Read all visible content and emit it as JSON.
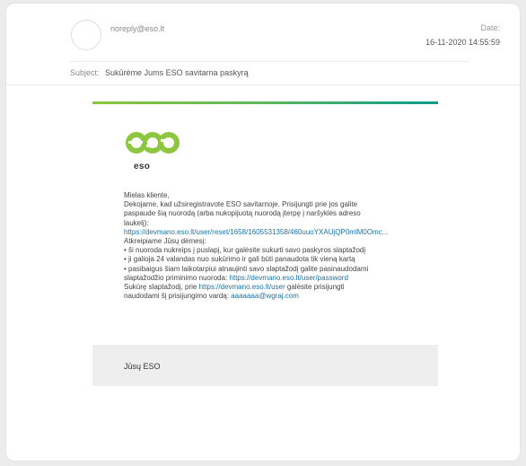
{
  "email": {
    "sender": "noreply@eso.lt",
    "date_label": "Date:",
    "date": "16-11-2020 14:55:59",
    "subject_label": "Subject:",
    "subject": "Sukūrėme Jums ESO savitarna paskyrą"
  },
  "message": {
    "logo_text": "eso",
    "greeting": "Mielas kliente,",
    "para1_line1": "Dekojame, kad užsiregistravote ESO savitarnoje. Prisijungti prie jos galite",
    "para1_line2": "paspaude šią nuorodą (arba nukopijuotą nuorodą įterpę į naršyklės adreso",
    "para1_line3": "laukelį):",
    "reset_link": "https://devmano.eso.lt/user/reset/1658/1605531358/460uuoYXAUjQP0mlM0Omc...",
    "attention": "Atkreipiame Jūsų dėmesį:",
    "bullet1": "• ši nuoroda nukreips į puslapį, kur galėsite sukurti savo paskyros slaptažodį",
    "bullet2": "• ji galioja 24 valandas nuo sukūrimo ir gali būti panaudota tik vieną kartą",
    "bullet3_line1": "• pasibaigus šiam laikotarpiui atnaujinti savo slaptažodį galite pasinaudodami",
    "bullet3_line2_prefix": "slaptažodžio priminimo nuoroda: ",
    "password_link": "https://devmano.eso.lt/user/password",
    "created_prefix": "Sukūrę slaptažodį, prie ",
    "user_link": "https://devmano.eso.lt/user",
    "created_suffix": " galėsite prisijungti",
    "username_prefix": "naudodami šį prisijungimo vardą: ",
    "username_link": "aaaaaaa@wgraj.com",
    "signature": "Jūsų ESO"
  },
  "colors": {
    "brand_green": "#8dc63f",
    "brand_teal": "#0a9a8a",
    "link": "#1a73a8"
  },
  "icons": {
    "avatar": "avatar-placeholder-circle",
    "logo": "eso-logo"
  }
}
